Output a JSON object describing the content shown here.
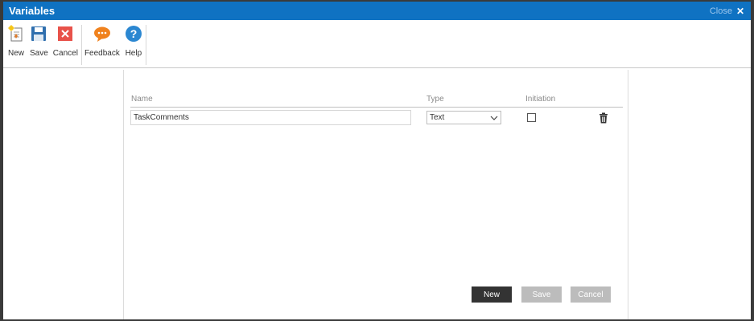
{
  "dialog": {
    "title": "Variables",
    "close_label": "Close",
    "close_icon": "x-icon",
    "accent_color": "#0f72c2"
  },
  "ribbon": {
    "groups": [
      [
        {
          "label": "New",
          "icon": "new-document-icon"
        },
        {
          "label": "Save",
          "icon": "floppy-disk-icon"
        },
        {
          "label": "Cancel",
          "icon": "red-x-icon"
        }
      ],
      [
        {
          "label": "Feedback",
          "icon": "speech-bubble-icon"
        },
        {
          "label": "Help",
          "icon": "question-mark-icon"
        }
      ]
    ]
  },
  "grid": {
    "columns": {
      "name": "Name",
      "type": "Type",
      "initiation": "Initiation"
    },
    "rows": [
      {
        "name": "TaskComments",
        "type": "Text",
        "initiation": false
      }
    ]
  },
  "footer": {
    "new_label": "New",
    "save_label": "Save",
    "cancel_label": "Cancel",
    "primary_color": "#333333",
    "disabled_color": "#bcbcbc"
  }
}
